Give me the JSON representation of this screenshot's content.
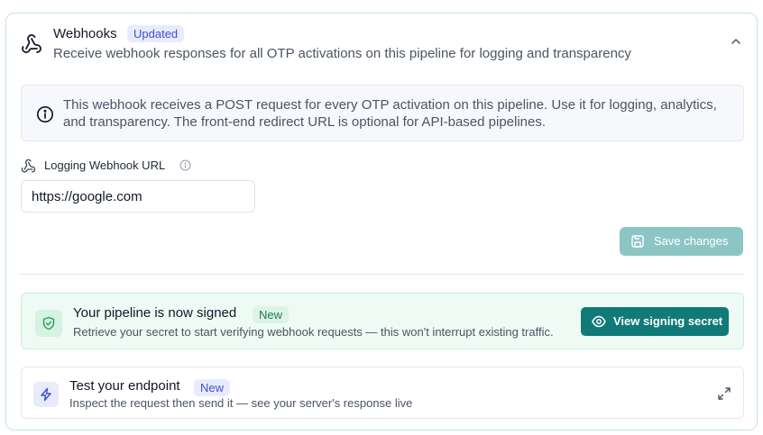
{
  "header": {
    "title": "Webhooks",
    "badge": "Updated",
    "subtitle": "Receive webhook responses for all OTP activations on this pipeline for logging and transparency"
  },
  "info": {
    "text": "This webhook receives a POST request for every OTP activation on this pipeline. Use it for logging, analytics, and transparency. The front-end redirect URL is optional for API-based pipelines."
  },
  "field": {
    "label": "Logging Webhook URL",
    "value": "https://google.com"
  },
  "save": {
    "label": "Save changes"
  },
  "signed": {
    "title": "Your pipeline is now signed",
    "badge": "New",
    "subtitle": "Retrieve your secret to start verifying webhook requests — this won't interrupt existing traffic.",
    "button": "View signing secret"
  },
  "test": {
    "title": "Test your endpoint",
    "badge": "New",
    "subtitle": "Inspect the request then send it — see your server's response live"
  },
  "colors": {
    "accent": "#117a78",
    "accent_disabled": "#8cc6c4",
    "badge_blue_bg": "#e8ebfd",
    "badge_green_bg": "#ddf3e6",
    "signed_bg": "#eefaf4"
  }
}
